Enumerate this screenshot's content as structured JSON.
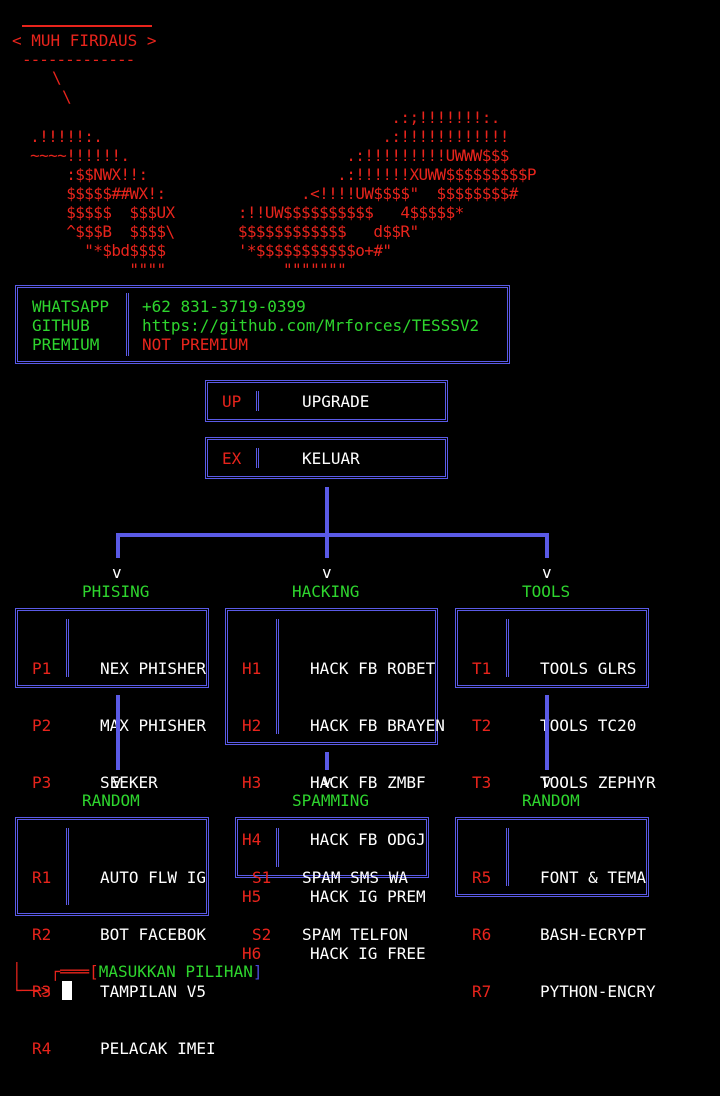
{
  "banner": {
    "name": "< MUH FIRDAUS >",
    "art": "                                          .:;!!!!!!!:.\n  .!!!!!:.                               .:!!!!!!!!!!!!\n  ~~~~!!!!!!.                        .:!!!!!!!!!UWWW$$$\n      :$$NWX!!:                     .:!!!!!!XUWW$$$$$$$$$P\n      $$$$$##WX!:               .<!!!!UW$$$$\"  $$$$$$$$#\n      $$$$$  $$$UX       :!!UW$$$$$$$$$$   4$$$$$*\n      ^$$$B  $$$$\\       $$$$$$$$$$$$   d$$R\"\n        \"*$bd$$$$        '*$$$$$$$$$$$o+#\"\n             \"\"\"\"             \"\"\"\"\"\"\""
  },
  "info": {
    "labels": [
      "WHATSAPP",
      "GITHUB",
      "PREMIUM"
    ],
    "whatsapp": "+62 831-3719-0399",
    "github": "https://github.com/Mrforces/TESSSV2",
    "premium": "NOT PREMIUM"
  },
  "actions": [
    {
      "code": "UP",
      "label": "UPGRADE"
    },
    {
      "code": "EX",
      "label": "KELUAR"
    }
  ],
  "categories": [
    {
      "title": "PHISING",
      "items": [
        {
          "code": "P1",
          "label": "NEX PHISHER"
        },
        {
          "code": "P2",
          "label": "MAX PHISHER"
        },
        {
          "code": "P3",
          "label": "SEEKER"
        }
      ]
    },
    {
      "title": "HACKING",
      "items": [
        {
          "code": "H1",
          "label": "HACK FB ROBET"
        },
        {
          "code": "H2",
          "label": "HACK FB BRAYEN"
        },
        {
          "code": "H3",
          "label": "HACK FB ZMBF"
        },
        {
          "code": "H4",
          "label": "HACK FB ODGJ"
        },
        {
          "code": "H5",
          "label": "HACK IG PREM"
        },
        {
          "code": "H6",
          "label": "HACK IG FREE"
        }
      ]
    },
    {
      "title": "TOOLS",
      "items": [
        {
          "code": "T1",
          "label": "TOOLS GLRS"
        },
        {
          "code": "T2",
          "label": "TOOLS TC20"
        },
        {
          "code": "T3",
          "label": "TOOLS ZEPHYR"
        }
      ]
    }
  ],
  "subcategories": [
    {
      "title": "RANDOM",
      "items": [
        {
          "code": "R1",
          "label": "AUTO FLW IG"
        },
        {
          "code": "R2",
          "label": "BOT FACEBOK"
        },
        {
          "code": "R3",
          "label": "TAMPILAN V5"
        },
        {
          "code": "R4",
          "label": "PELACAK IMEI"
        }
      ]
    },
    {
      "title": "SPAMMING",
      "items": [
        {
          "code": "S1",
          "label": "SPAM SMS WA"
        },
        {
          "code": "S2",
          "label": "SPAM TELFON"
        }
      ]
    },
    {
      "title": "RANDOM",
      "items": [
        {
          "code": "R5",
          "label": "FONT & TEMA"
        },
        {
          "code": "R6",
          "label": "BASH-ECRYPT"
        },
        {
          "code": "R7",
          "label": "PYTHON-ENCRY"
        }
      ]
    }
  ],
  "arrow_glyph": "v",
  "prompt": {
    "prefix": "┌═══[",
    "label": "MASUKKAN PILIHAN",
    "suffix": "]",
    "pipe": "│",
    "arrow": "└──>"
  }
}
